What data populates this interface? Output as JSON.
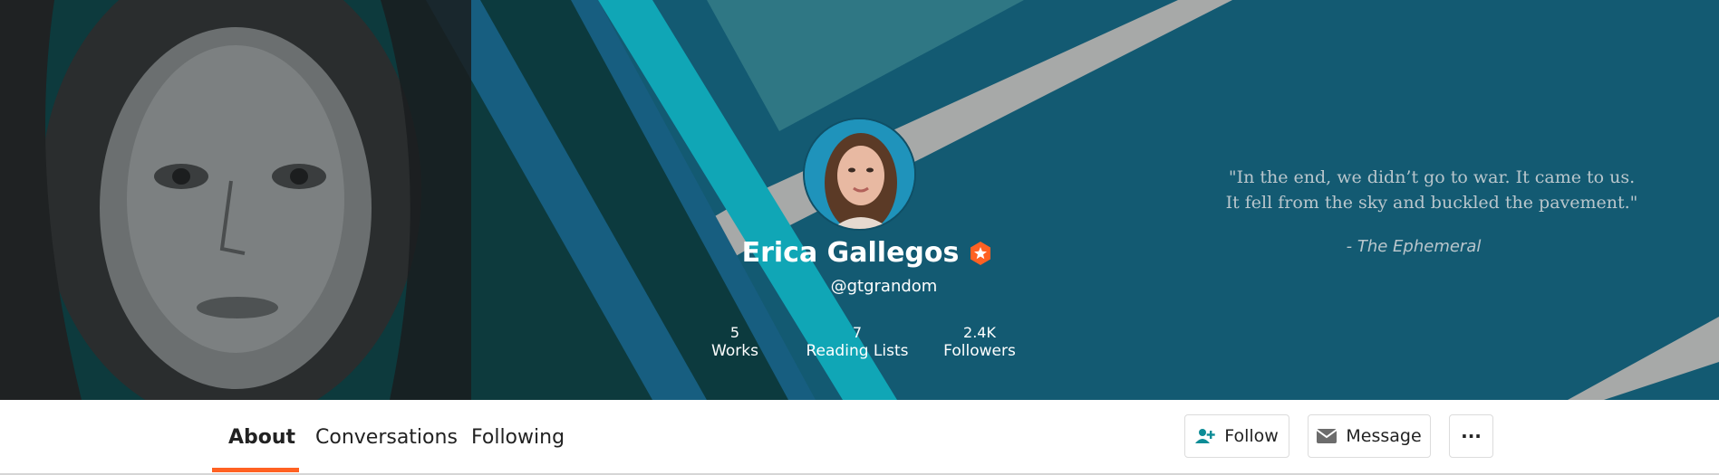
{
  "profile": {
    "name": "Erica Gallegos",
    "handle": "@gtgrandom",
    "stats": [
      {
        "value": "5",
        "label": "Works"
      },
      {
        "value": "7",
        "label": "Reading Lists"
      },
      {
        "value": "2.4K",
        "label": "Followers"
      }
    ]
  },
  "banner": {
    "quote_line1": "\"In the end, we didn’t go to war.  It came to us.",
    "quote_line2": "It fell from the sky and buckled the pavement.\"",
    "quote_attribution": "- The Ephemeral"
  },
  "tabs": [
    {
      "label": "About",
      "active": true
    },
    {
      "label": "Conversations",
      "active": false
    },
    {
      "label": "Following",
      "active": false
    }
  ],
  "actions": {
    "follow_label": "Follow",
    "message_label": "Message",
    "more_label": "···"
  },
  "colors": {
    "accent": "#ff6122",
    "banner_bg": "#135a72",
    "teal": "#0fa9b8"
  },
  "icons": {
    "badge": "star-badge-icon",
    "follow": "add-user-icon",
    "message": "envelope-icon",
    "more": "ellipsis-icon"
  }
}
